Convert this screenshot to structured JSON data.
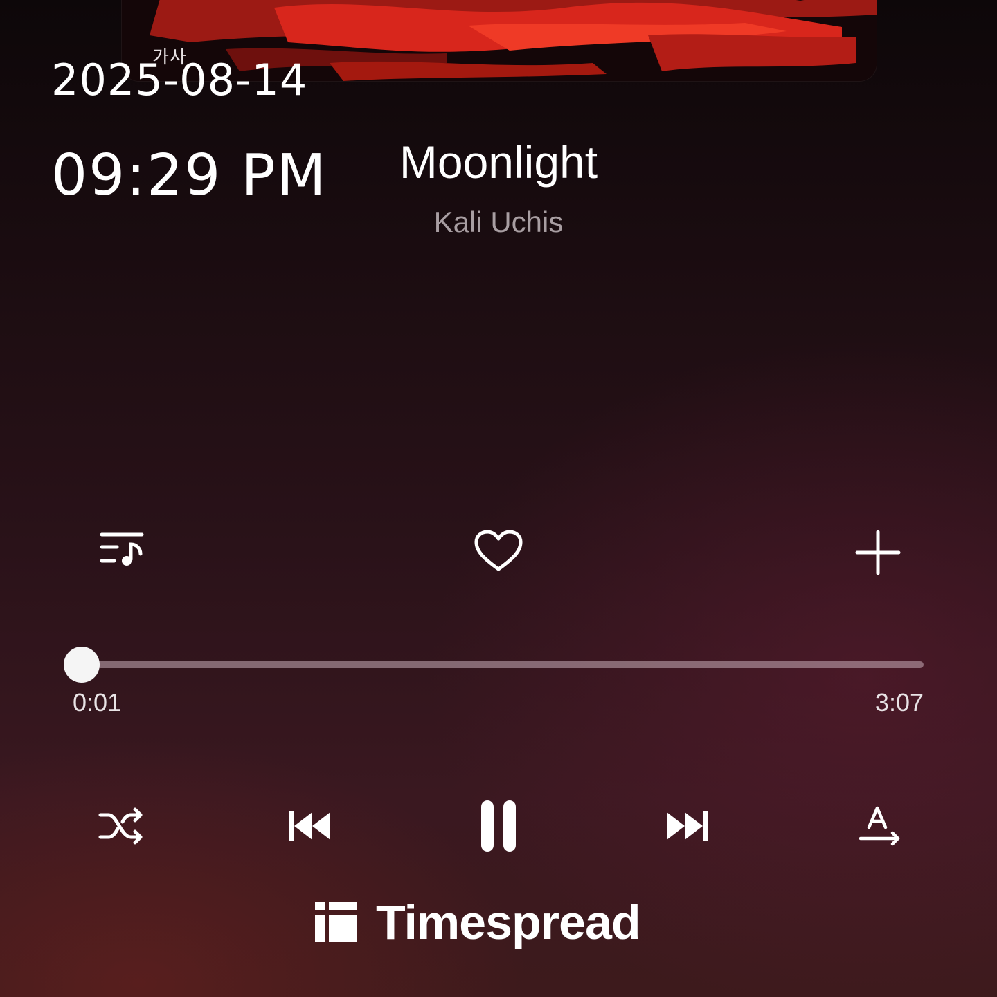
{
  "overlay": {
    "date": "2025-08-14",
    "time": "09:29 PM"
  },
  "lyrics_label": "가사",
  "track": {
    "title": "Moonlight",
    "artist": "Kali Uchis"
  },
  "actions": {
    "queue_icon": "playlist-music-icon",
    "like_icon": "heart-outline-icon",
    "add_icon": "plus-icon"
  },
  "progress": {
    "elapsed": "0:01",
    "duration": "3:07",
    "fraction": 0.005
  },
  "controls": {
    "shuffle_icon": "shuffle-icon",
    "previous_icon": "skip-previous-icon",
    "pause_icon": "pause-icon",
    "next_icon": "skip-next-icon",
    "translate_icon": "translate-icon"
  },
  "watermark": {
    "brand": "Timespread"
  },
  "colors": {
    "accent_red": "#d8261c",
    "artist_gray": "#a89ea2"
  }
}
